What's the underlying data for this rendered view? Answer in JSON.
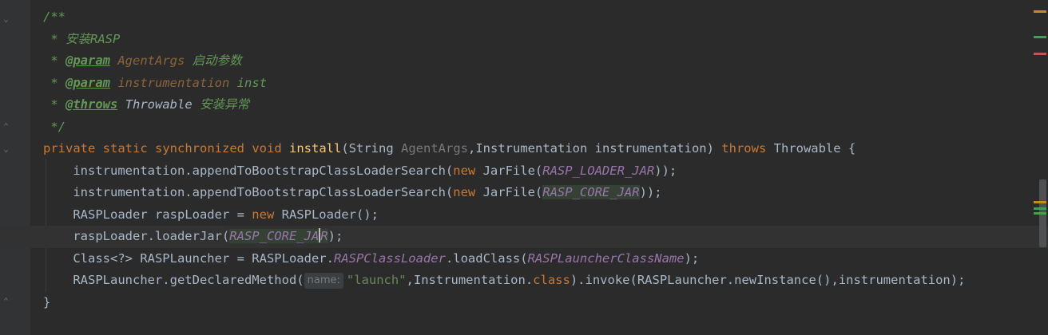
{
  "editor": {
    "doc": {
      "open": "/**",
      "summary": " * 安装RASP",
      "star": " * ",
      "param_tag": "@param",
      "param1_name": "AgentArgs",
      "param1_desc": " 启动参数",
      "param2_name": "instrumentation",
      "param2_desc": " inst",
      "throws_tag": "@throws",
      "throws_type": "Throwable",
      "throws_desc": " 安装异常",
      "close": " */"
    },
    "signature": {
      "private": "private",
      "static": "static",
      "synchronized": "synchronized",
      "void": "void",
      "name": "install",
      "open_paren": "(String ",
      "arg1": "AgentArgs",
      "sep": ",Instrumentation instrumentation) ",
      "throws": "throws",
      "rest": " Throwable {"
    },
    "body": {
      "l1_a": "instrumentation.appendToBootstrapClassLoaderSearch(",
      "new": "new",
      "jarfile": " JarFile(",
      "loader_jar": "RASP_LOADER_JAR",
      "close_semi_a": "));",
      "core_jar": "RASP_CORE_JAR",
      "l3_a": "RASPLoader raspLoader = ",
      "l3_b": " RASPLoader();",
      "l4_a": "raspLoader.loaderJar(",
      "core_jar_a": "RASP_CORE_JA",
      "core_jar_b": "R",
      "l4_b": ");",
      "l5_a": "Class<?> RASPLauncher = RASPLoader.",
      "l5_field": "RASPClassLoader",
      "l5_b": ".loadClass(",
      "l5_arg": "RASPLauncherClassName",
      "l5_c": ");",
      "l6_a": "RASPLauncher.getDeclaredMethod(",
      "hint": "name:",
      "l6_str": "\"launch\"",
      "l6_b": ",Instrumentation.",
      "l6_class": "class",
      "l6_c": ").invoke(RASPLauncher.newInstance(),instrumentation);",
      "end": "}"
    },
    "marker_colors": [
      "#be9117",
      "#499c54",
      "#c75450",
      "#be9117",
      "#499c54"
    ]
  }
}
